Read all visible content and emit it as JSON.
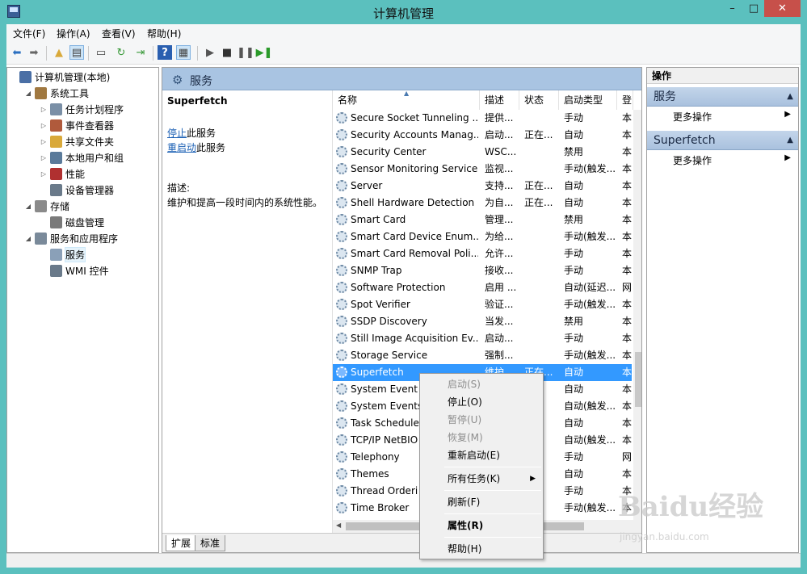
{
  "window": {
    "title": "计算机管理",
    "min": "–",
    "max": "□",
    "close": "✕"
  },
  "menu": [
    "文件(F)",
    "操作(A)",
    "查看(V)",
    "帮助(H)"
  ],
  "tree": [
    {
      "label": "计算机管理(本地)",
      "indent": 0,
      "twisty": "",
      "icon": "computer-icon",
      "color": "#4a6fa5"
    },
    {
      "label": "系统工具",
      "indent": 1,
      "twisty": "◢",
      "icon": "tools-icon",
      "color": "#a07840"
    },
    {
      "label": "任务计划程序",
      "indent": 2,
      "twisty": "▷",
      "icon": "clock-icon",
      "color": "#7a8fa6"
    },
    {
      "label": "事件查看器",
      "indent": 2,
      "twisty": "▷",
      "icon": "event-viewer-icon",
      "color": "#b05a3c"
    },
    {
      "label": "共享文件夹",
      "indent": 2,
      "twisty": "▷",
      "icon": "shared-folder-icon",
      "color": "#d9a93a"
    },
    {
      "label": "本地用户和组",
      "indent": 2,
      "twisty": "▷",
      "icon": "users-icon",
      "color": "#5a7a9a"
    },
    {
      "label": "性能",
      "indent": 2,
      "twisty": "▷",
      "icon": "performance-icon",
      "color": "#b03030"
    },
    {
      "label": "设备管理器",
      "indent": 2,
      "twisty": "",
      "icon": "device-manager-icon",
      "color": "#6a7a8a"
    },
    {
      "label": "存储",
      "indent": 1,
      "twisty": "◢",
      "icon": "storage-icon",
      "color": "#8a8a8a"
    },
    {
      "label": "磁盘管理",
      "indent": 2,
      "twisty": "",
      "icon": "disk-icon",
      "color": "#7a7a7a"
    },
    {
      "label": "服务和应用程序",
      "indent": 1,
      "twisty": "◢",
      "icon": "services-apps-icon",
      "color": "#7a8a9a"
    },
    {
      "label": "服务",
      "indent": 2,
      "twisty": "",
      "icon": "services-icon",
      "color": "#8aa0b8",
      "selected": true
    },
    {
      "label": "WMI 控件",
      "indent": 2,
      "twisty": "",
      "icon": "wmi-icon",
      "color": "#6a7a8a"
    }
  ],
  "center": {
    "header": "服务",
    "service_name": "Superfetch",
    "stop_link": "停止",
    "stop_suffix": "此服务",
    "restart_link": "重启动",
    "restart_suffix": "此服务",
    "desc_label": "描述:",
    "desc_text": "维护和提高一段时间内的系统性能。",
    "sort_arrow": "▲"
  },
  "columns": [
    "名称",
    "描述",
    "状态",
    "启动类型",
    "登"
  ],
  "services": [
    {
      "name": "Secure Socket Tunneling ...",
      "desc": "提供...",
      "status": "",
      "startup": "手动",
      "logon": "本"
    },
    {
      "name": "Security Accounts Manag...",
      "desc": "启动...",
      "status": "正在...",
      "startup": "自动",
      "logon": "本"
    },
    {
      "name": "Security Center",
      "desc": "WSC...",
      "status": "",
      "startup": "禁用",
      "logon": "本"
    },
    {
      "name": "Sensor Monitoring Service",
      "desc": "监视...",
      "status": "",
      "startup": "手动(触发...",
      "logon": "本"
    },
    {
      "name": "Server",
      "desc": "支持...",
      "status": "正在...",
      "startup": "自动",
      "logon": "本"
    },
    {
      "name": "Shell Hardware Detection",
      "desc": "为自...",
      "status": "正在...",
      "startup": "自动",
      "logon": "本"
    },
    {
      "name": "Smart Card",
      "desc": "管理...",
      "status": "",
      "startup": "禁用",
      "logon": "本"
    },
    {
      "name": "Smart Card Device Enum...",
      "desc": "为给...",
      "status": "",
      "startup": "手动(触发...",
      "logon": "本"
    },
    {
      "name": "Smart Card Removal Poli...",
      "desc": "允许...",
      "status": "",
      "startup": "手动",
      "logon": "本"
    },
    {
      "name": "SNMP Trap",
      "desc": "接收...",
      "status": "",
      "startup": "手动",
      "logon": "本"
    },
    {
      "name": "Software Protection",
      "desc": "启用 ...",
      "status": "",
      "startup": "自动(延迟...",
      "logon": "网"
    },
    {
      "name": "Spot Verifier",
      "desc": "验证...",
      "status": "",
      "startup": "手动(触发...",
      "logon": "本"
    },
    {
      "name": "SSDP Discovery",
      "desc": "当发...",
      "status": "",
      "startup": "禁用",
      "logon": "本"
    },
    {
      "name": "Still Image Acquisition Ev...",
      "desc": "启动...",
      "status": "",
      "startup": "手动",
      "logon": "本"
    },
    {
      "name": "Storage Service",
      "desc": "强制...",
      "status": "",
      "startup": "手动(触发...",
      "logon": "本"
    },
    {
      "name": "Superfetch",
      "desc": "维护...",
      "status": "正在...",
      "startup": "自动",
      "logon": "本",
      "selected": true
    },
    {
      "name": "System Event N",
      "desc": "",
      "status": "",
      "startup": "自动",
      "logon": "本"
    },
    {
      "name": "System Events",
      "desc": "",
      "status": "",
      "startup": "自动(触发...",
      "logon": "本"
    },
    {
      "name": "Task Schedule",
      "desc": "",
      "status": "",
      "startup": "自动",
      "logon": "本"
    },
    {
      "name": "TCP/IP NetBIO",
      "desc": "",
      "status": "",
      "startup": "自动(触发...",
      "logon": "本"
    },
    {
      "name": "Telephony",
      "desc": "",
      "status": "",
      "startup": "手动",
      "logon": "网"
    },
    {
      "name": "Themes",
      "desc": "",
      "status": "",
      "startup": "自动",
      "logon": "本"
    },
    {
      "name": "Thread Orderi",
      "desc": "",
      "status": "",
      "startup": "手动",
      "logon": "本"
    },
    {
      "name": "Time Broker",
      "desc": "",
      "status": "",
      "startup": "手动(触发...",
      "logon": "本"
    }
  ],
  "tabs": [
    "扩展",
    "标准"
  ],
  "actions": {
    "title": "操作",
    "sections": [
      {
        "title": "服务",
        "more": "更多操作"
      },
      {
        "title": "Superfetch",
        "more": "更多操作"
      }
    ]
  },
  "context_menu": [
    {
      "label": "启动(S)",
      "disabled": true
    },
    {
      "label": "停止(O)"
    },
    {
      "label": "暂停(U)",
      "disabled": true
    },
    {
      "label": "恢复(M)",
      "disabled": true
    },
    {
      "label": "重新启动(E)"
    },
    {
      "sep": true
    },
    {
      "label": "所有任务(K)",
      "submenu": true
    },
    {
      "sep": true
    },
    {
      "label": "刷新(F)"
    },
    {
      "sep": true
    },
    {
      "label": "属性(R)",
      "bold": true
    },
    {
      "sep": true
    },
    {
      "label": "帮助(H)"
    }
  ],
  "watermark": {
    "brand": "Baidu经验",
    "url": "jingyan.baidu.com"
  }
}
